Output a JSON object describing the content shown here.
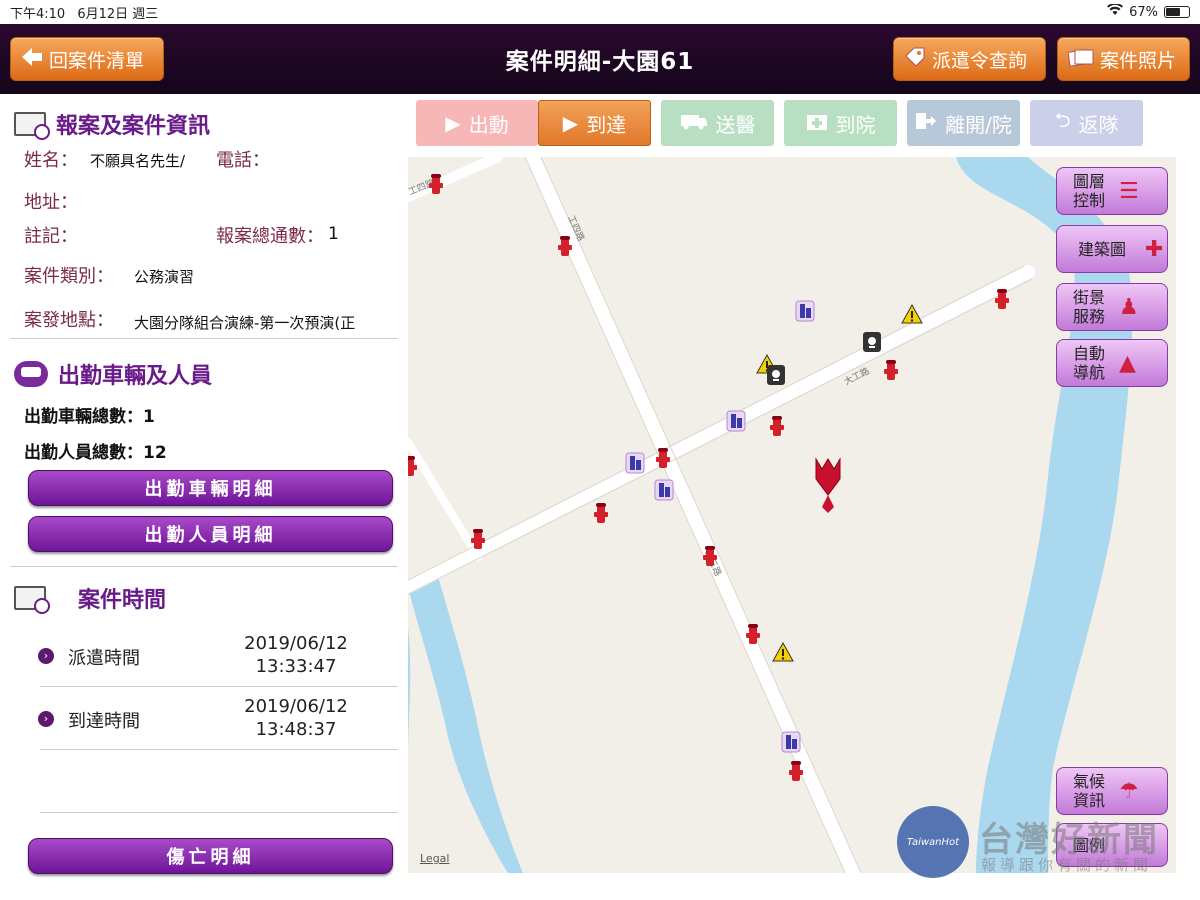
{
  "status_bar": {
    "time": "下午4:10",
    "date": "6月12日 週三",
    "battery": "67%",
    "battery_level": 0.67
  },
  "header": {
    "back_label": "回案件清單",
    "title": "案件明細-大園61",
    "dispatch_query_label": "派遣令查詢",
    "photos_label": "案件照片"
  },
  "report_section": {
    "title": "報案及案件資訊",
    "name_label": "姓名：",
    "name_value": "不願具名先生/",
    "phone_label": "電話：",
    "address_label": "地址：",
    "note_label": "註記：",
    "calls_label": "報案總通數：",
    "calls_value": "1",
    "type_label": "案件類別：",
    "type_value": "公務演習",
    "location_label": "案發地點：",
    "location_value": "大園分隊組合演練-第一次預演(正"
  },
  "vehicles_section": {
    "title": "出勤車輛及人員",
    "vehicles_total": "出勤車輛總數：1",
    "personnel_total": "出勤人員總數：12",
    "vehicle_detail_btn": "出勤車輛明細",
    "personnel_detail_btn": "出勤人員明細"
  },
  "time_section": {
    "title": "案件時間",
    "rows": [
      {
        "label": "派遣時間",
        "date": "2019/06/12",
        "time": "13:33:47"
      },
      {
        "label": "到達時間",
        "date": "2019/06/12",
        "time": "13:48:37"
      }
    ]
  },
  "casualty_btn": "傷亡明細",
  "actions": [
    {
      "label": "出動",
      "icon": "play-icon",
      "state": "disabled"
    },
    {
      "label": "到達",
      "icon": "play-icon",
      "state": "active"
    },
    {
      "label": "送醫",
      "icon": "ambulance-icon",
      "state": "disabled"
    },
    {
      "label": "到院",
      "icon": "hospital-icon",
      "state": "disabled"
    },
    {
      "label": "離開/院",
      "icon": "exit-icon",
      "state": "disabled"
    },
    {
      "label": "返隊",
      "icon": "return-icon",
      "state": "disabled"
    }
  ],
  "map": {
    "road_labels": [
      "工四路",
      "大工路",
      "工三路",
      "工四路"
    ],
    "buttons": {
      "layers": "圖層控制",
      "building": "建築圖",
      "street_view": "街景服務",
      "navigation": "自動導航",
      "weather": "氣候資訊",
      "legend": "圖例"
    },
    "legal": "Legal",
    "colors": {
      "water": "#a9d8ef",
      "land": "#f2efe8",
      "road": "#ffffff",
      "hydrant": "#d4202a",
      "marker": "#c8102e"
    }
  },
  "watermark": {
    "logo": "TaiwanHot",
    "title": "台灣好新聞",
    "subtitle": "報導跟你有關的新聞"
  }
}
